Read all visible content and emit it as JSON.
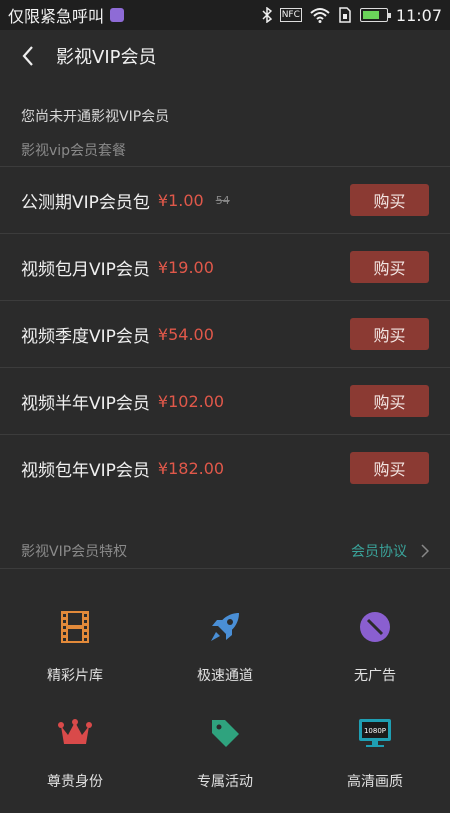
{
  "status_bar": {
    "carrier": "仅限紧急呼叫",
    "nfc": "NFC",
    "time": "11:07"
  },
  "header": {
    "title": "影视VIP会员"
  },
  "notice": "您尚未开通影视VIP会员",
  "packages_section_label": "影视vip会员套餐",
  "packages": [
    {
      "name": "公测期VIP会员包",
      "price": "¥1.00",
      "original": "54",
      "buy": "购买"
    },
    {
      "name": "视频包月VIP会员",
      "price": "¥19.00",
      "original": "",
      "buy": "购买"
    },
    {
      "name": "视频季度VIP会员",
      "price": "¥54.00",
      "original": "",
      "buy": "购买"
    },
    {
      "name": "视频半年VIP会员",
      "price": "¥102.00",
      "original": "",
      "buy": "购买"
    },
    {
      "name": "视频包年VIP会员",
      "price": "¥182.00",
      "original": "",
      "buy": "购买"
    }
  ],
  "privileges_section": {
    "title": "影视VIP会员特权",
    "agreement": "会员协议"
  },
  "privileges": [
    {
      "label": "精彩片库",
      "icon": "film-icon"
    },
    {
      "label": "极速通道",
      "icon": "rocket-icon"
    },
    {
      "label": "无广告",
      "icon": "no-ads-icon"
    },
    {
      "label": "尊贵身份",
      "icon": "crown-icon"
    },
    {
      "label": "专属活动",
      "icon": "tag-icon"
    },
    {
      "label": "高清画质",
      "icon": "hd-screen-icon"
    }
  ],
  "hd_badge_text": "1080P",
  "colors": {
    "accent_price": "#e0584a",
    "buy_button": "#8b3a33",
    "agreement_link": "#3aa39a"
  }
}
